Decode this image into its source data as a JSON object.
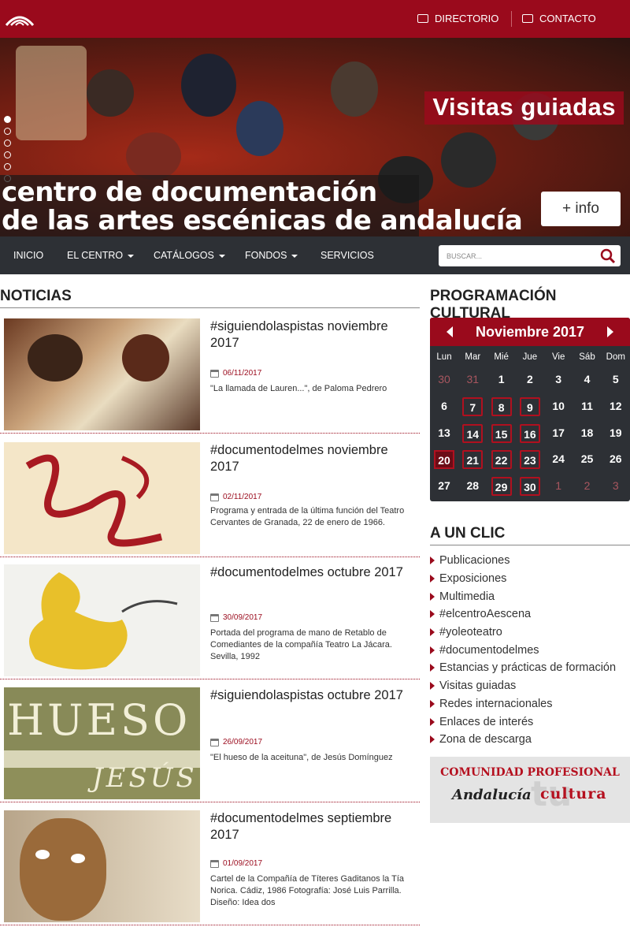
{
  "header": {
    "directorio_label": "DIRECTORIO",
    "contacto_label": "CONTACTO",
    "brand_color": "#9a0a1c"
  },
  "hero": {
    "slide_title": "Visitas guiadas",
    "site_title_line1": "centro de documentación",
    "site_title_line2": "de las artes escénicas de andalucía",
    "info_button": "+ info",
    "slides_count": 6,
    "active_slide": 1
  },
  "nav": {
    "items": [
      {
        "label": "INICIO",
        "dropdown": false
      },
      {
        "label": "EL CENTRO",
        "dropdown": true
      },
      {
        "label": "CATÁLOGOS",
        "dropdown": true
      },
      {
        "label": "FONDOS",
        "dropdown": true
      },
      {
        "label": "SERVICIOS",
        "dropdown": false
      }
    ],
    "search_placeholder": "BUSCAR..."
  },
  "news": {
    "title": "NOTICIAS",
    "items": [
      {
        "title": "#siguiendolaspistas noviembre 2017",
        "date": "06/11/2017",
        "desc": "\"La llamada de Lauren...\", de Paloma Pedrero"
      },
      {
        "title": "#documentodelmes noviembre 2017",
        "date": "02/11/2017",
        "desc": "Programa y entrada de la última función del Teatro Cervantes de Granada, 22 de enero de 1966."
      },
      {
        "title": "#documentodelmes octubre 2017",
        "date": "30/09/2017",
        "desc": "Portada del programa de mano de Retablo de Comediantes de la compañía Teatro La Jácara. Sevilla, 1992"
      },
      {
        "title": "#siguiendolaspistas octubre 2017",
        "date": "26/09/2017",
        "desc": "\"El hueso de la aceituna\", de Jesús Domínguez"
      },
      {
        "title": "#documentodelmes septiembre 2017",
        "date": "01/09/2017",
        "desc": "Cartel de la Compañía de Títeres Gaditanos la Tía Norica. Cádiz, 1986 Fotografía: José Luis Parrilla. Diseño: Idea dos"
      }
    ],
    "thumb_texts": {
      "hueso": "HUESO D",
      "jesus": "JESÚS"
    }
  },
  "calendar": {
    "title": "PROGRAMACIÓN CULTURAL",
    "month": "Noviembre 2017",
    "weekdays": [
      "Lun",
      "Mar",
      "Mié",
      "Jue",
      "Vie",
      "Sáb",
      "Dom"
    ],
    "weeks": [
      [
        "30",
        "31",
        "1",
        "2",
        "3",
        "4",
        "5"
      ],
      [
        "6",
        "7",
        "8",
        "9",
        "10",
        "11",
        "12"
      ],
      [
        "13",
        "14",
        "15",
        "16",
        "17",
        "18",
        "19"
      ],
      [
        "20",
        "21",
        "22",
        "23",
        "24",
        "25",
        "26"
      ],
      [
        "27",
        "28",
        "29",
        "30",
        "1",
        "2",
        "3"
      ]
    ],
    "event_days": [
      "7",
      "8",
      "9",
      "14",
      "15",
      "16",
      "21",
      "22",
      "23",
      "29",
      "30"
    ],
    "today": "20"
  },
  "aunclic": {
    "title": "A UN CLIC",
    "links": [
      "Publicaciones",
      "Exposiciones",
      "Multimedia",
      "#elcentroAescena",
      "#yoleoteatro",
      "#documentodelmes",
      "Estancias y prácticas de formación",
      "Visitas guiadas",
      "Redes internacionales",
      "Enlaces de interés",
      "Zona de descarga"
    ]
  },
  "banner": {
    "line1": "COMUNIDAD PROFESIONAL",
    "andalucia": "Andalucía",
    "cultura": "cultura",
    "watermark": "tu"
  }
}
